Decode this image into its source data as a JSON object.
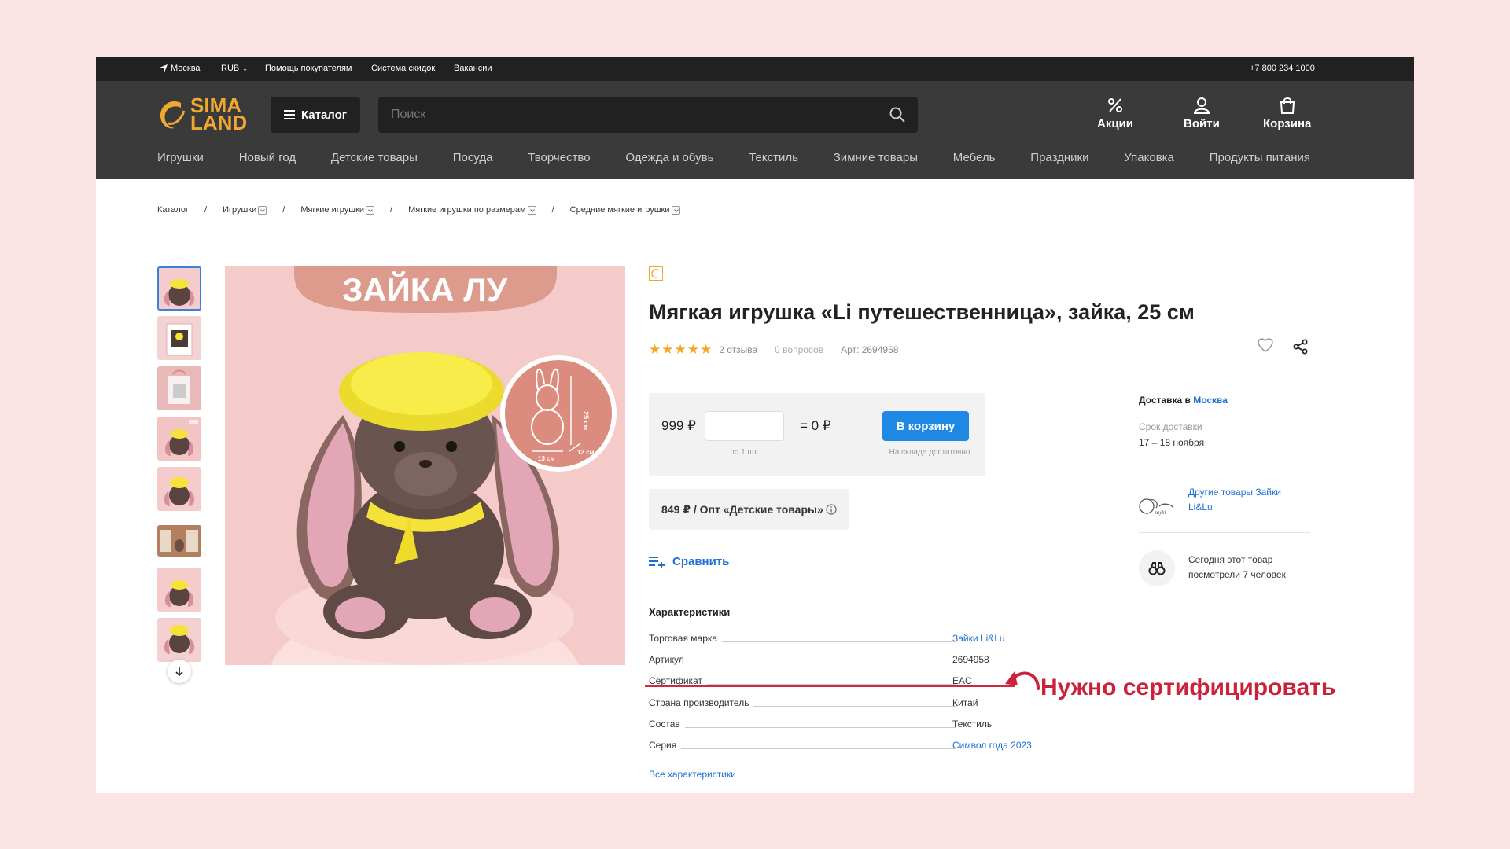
{
  "topbar": {
    "city": "Москва",
    "currency": "RUB",
    "help": "Помощь покупателям",
    "discounts": "Система скидок",
    "jobs": "Вакансии",
    "phone": "+7 800 234 1000"
  },
  "header": {
    "logo_line1": "SIMA",
    "logo_line2": "LAND",
    "catalog": "Каталог",
    "search_placeholder": "Поиск",
    "actions": [
      {
        "label": "Акции",
        "icon": "percent-icon"
      },
      {
        "label": "Войти",
        "icon": "user-icon"
      },
      {
        "label": "Корзина",
        "icon": "bag-icon"
      }
    ]
  },
  "nav": [
    "Игрушки",
    "Новый год",
    "Детские товары",
    "Посуда",
    "Творчество",
    "Одежда и обувь",
    "Текстиль",
    "Зимние товары",
    "Мебель",
    "Праздники",
    "Упаковка",
    "Продукты питания"
  ],
  "breadcrumb": [
    "Каталог",
    "Игрушки",
    "Мягкие игрушки",
    "Мягкие игрушки по размерам",
    "Средние мягкие игрушки"
  ],
  "photo": {
    "banner": "ЗАЙКА ЛУ",
    "height": "25 см",
    "width": "13 см",
    "depth": "12 см"
  },
  "product": {
    "title": "Мягкая игрушка «Li путешественница», зайка, 25 см",
    "rating": 5,
    "reviews": "2 отзыва",
    "questions": "0 вопросов",
    "sku": "Арт: 2694958"
  },
  "buy": {
    "price": "999 ₽",
    "qty": "",
    "qty_hint": "по 1 шт.",
    "sum": "= 0 ₽",
    "cart": "В корзину",
    "stock": "На складе достаточно"
  },
  "opt": "849 ₽ / Опт «Детские товары»",
  "compare": "Сравнить",
  "characteristics": {
    "title": "Характеристики",
    "rows": [
      {
        "k": "Торговая марка",
        "v": "Зайки Li&Lu"
      },
      {
        "k": "Артикул",
        "v": "2694958"
      },
      {
        "k": "Сертификат",
        "v": "EAC"
      },
      {
        "k": "Страна производитель",
        "v": "Китай"
      },
      {
        "k": "Состав",
        "v": "Текстиль"
      },
      {
        "k": "Серия",
        "v": "Символ года 2023"
      }
    ],
    "all": "Все характеристики"
  },
  "annotation": "Нужно сертифицировать",
  "side": {
    "delivery_prefix": "Доставка в",
    "delivery_city": "Москва",
    "delivery_label": "Срок доставки",
    "delivery_date": "17 – 18 ноября",
    "brand_link": "Другие товары Зайки Li&Lu",
    "views": "Сегодня этот товар посмотрели 7 человек"
  },
  "colors": {
    "accent": "#1e88e5",
    "annotation": "#c8233a",
    "logo": "#f0a832"
  }
}
